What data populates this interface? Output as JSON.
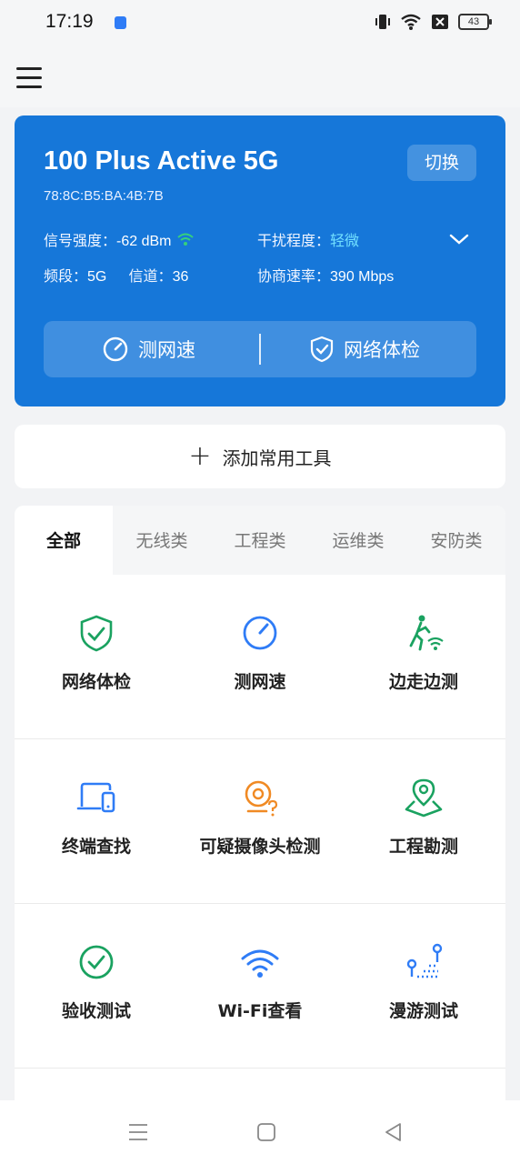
{
  "status": {
    "time": "17:19",
    "battery": "43"
  },
  "card": {
    "ssid": "100 Plus Active 5G",
    "mac": "78:8C:B5:BA:4B:7B",
    "switch_label": "切换",
    "signal_label": "信号强度：",
    "signal_value": "-62 dBm",
    "interference_label": "干扰程度：",
    "interference_value": "轻微",
    "band_label": "频段：",
    "band_value": "5G",
    "channel_label": "信道：",
    "channel_value": "36",
    "rate_label": "协商速率：",
    "rate_value": "390 Mbps",
    "speedtest_label": "测网速",
    "checkup_label": "网络体检"
  },
  "addtool": {
    "label": "添加常用工具"
  },
  "tabs": [
    "全部",
    "无线类",
    "工程类",
    "运维类",
    "安防类"
  ],
  "tools": [
    {
      "label": "网络体检",
      "icon": "shield-check-icon"
    },
    {
      "label": "测网速",
      "icon": "speedometer-icon"
    },
    {
      "label": "边走边测",
      "icon": "walking-wifi-icon"
    },
    {
      "label": "终端查找",
      "icon": "devices-icon"
    },
    {
      "label": "可疑摄像头检测",
      "icon": "camera-question-icon"
    },
    {
      "label": "工程勘测",
      "icon": "map-pin-icon"
    },
    {
      "label": "验收测试",
      "icon": "check-circle-icon"
    },
    {
      "label": "Wi-Fi查看",
      "icon": "wifi-icon"
    },
    {
      "label": "漫游测试",
      "icon": "roaming-path-icon"
    }
  ],
  "colors": {
    "card_blue": "#1677d9",
    "green": "#1aa260",
    "blue": "#2f7cf6",
    "orange": "#f08a24",
    "highlight": "#72e0ff"
  }
}
